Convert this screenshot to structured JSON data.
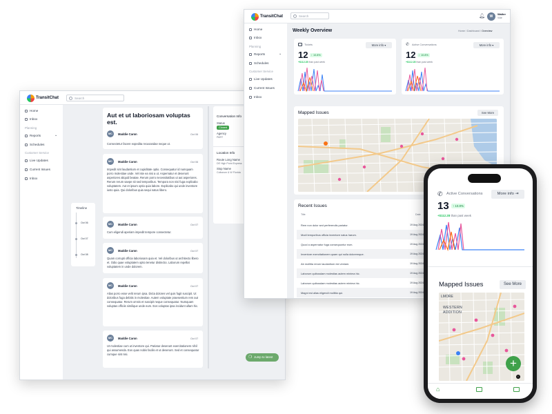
{
  "brand": {
    "name": "TransitChat"
  },
  "search": {
    "placeholder": "Search"
  },
  "nav": {
    "home": "Home",
    "inbox": "Inbox",
    "planning": "Planning",
    "reports": "Reports",
    "schedules": "Schedules",
    "customer_service": "Customer Service",
    "live_updates": "Live Updates",
    "current_issues": "Current Issues",
    "inbox2": "Inbox"
  },
  "conversation": {
    "title": "Aut et ut laboriosam voluptas est.",
    "messages": [
      {
        "initials": "MC",
        "author": "Maddie Caron",
        "date": "Oct 06",
        "text": "Consectetur facere expedita recusandae neque ut."
      },
      {
        "initials": "MC",
        "author": "Maddie Caron",
        "date": "Oct 06",
        "text": "Impedit sint laudantium et cupiditate optio. Consequatur id numquam porro molestiae unde. Vel iste ea nisi a ut. Aspernatur et deserunt asperiores aliquid beatae. Rerum porro necessitatibus ut aut asperiores. Rerum rerum saepe sit sed temporibus. Tempora non nisi fuga explicabo voluptatem. Aut et ipsum optio quia labore. Explicabo qui unde inventore iusto quia. Qui doloribus quia sequi natus libero."
      },
      {
        "initials": "MC",
        "author": "Maddie Caron",
        "date": "Oct 07",
        "text": "Cum eligendi aperiam impedit tempore consectetur."
      },
      {
        "initials": "MC",
        "author": "Maddie Caron",
        "date": "Oct 07",
        "text": "Quam corrupti officia laboriosam quia et. Vel doloribus ut architecto libero et. Odio quae voluptatem optio tenetur distinctio. Laborum repellat voluptatem in unde dolorem."
      },
      {
        "initials": "MC",
        "author": "Maddie Caron",
        "date": "Oct 07",
        "text": "Alias porro esse velit rerum ipsa. Dicta dolores vel quis fugit suscipit. Ut doloribus fuga debitis in molestiae. Autem voluptate praesentium rem aut consequatur. Rerum omnis et suscipit neque consequatur. Numquam voluptas officiis similique unde eum. Eos voluptas ipsa incidunt ullam hic."
      },
      {
        "initials": "MC",
        "author": "Maddie Caron",
        "date": "Oct 07",
        "text": "Ut molestiae cum ut inventore qui. Pariatur deserunt exercitationem nihil qui assumenda. Eos quas nobis facilis et ut deserunt. Sed et consequatur cumque sint nisi."
      }
    ]
  },
  "timeline": {
    "title": "Timeline",
    "dates": [
      "Oct 06",
      "Oct 07",
      "Oct 08"
    ]
  },
  "info_panel": {
    "conversation_info": "Conversation Info",
    "status_label": "Status",
    "status_value": "Closed",
    "agency_label": "Agency",
    "agency_value": "PART",
    "location_info": "Location Info",
    "route_label": "Route Long Name",
    "route_value": "DE High Point Express",
    "stop_label": "Stop Name",
    "stop_value": "Coliseum & W Florida"
  },
  "jump_button": {
    "label": "Jump to latest"
  },
  "dashboard": {
    "title": "Weekly Overview",
    "breadcrumb": [
      "Home",
      "Dashboard",
      "Overview"
    ],
    "user": {
      "name": "Walter",
      "role": "Vide",
      "initial": "W"
    },
    "tickets": {
      "label": "Tickets",
      "value": "12",
      "change": "10.8%",
      "delta": "+$112.28",
      "period": "than past week"
    },
    "conversations": {
      "label": "Active Conversations",
      "value": "12",
      "change": "10.8%",
      "delta": "+$112.28",
      "period": "than past week"
    },
    "more_info": "More info",
    "mapped_issues": "Mapped Issues",
    "see_more": "See More",
    "recent_issues": "Recent Issues",
    "table_headers": {
      "title": "Title",
      "date": "Date"
    },
    "issues": [
      {
        "title": "Rem non dolor sed perferendis pariatur.",
        "date": "19 Aug 2024"
      },
      {
        "title": "Modi temporibus officia inventore natus harum.",
        "date": "19 Aug 2024"
      },
      {
        "title": "Quod a aspernatur fuga consequuntur eum.",
        "date": "19 Aug 2024"
      },
      {
        "title": "Inventore exercitationem quam qui nulla doloremque.",
        "date": "19 Aug 2024"
      },
      {
        "title": "Ab mollitia rerum laudantium est veniam.",
        "date": "19 Aug 2024"
      },
      {
        "title": "Laborum quibusdam molestias autem minima hic.",
        "date": "19 Aug 2024"
      },
      {
        "title": "Laborum quibusdam molestias autem minima hic.",
        "date": "19 Aug 2024"
      },
      {
        "title": "Magni est alias eligendi mollitia qui.",
        "date": "19 Aug 2024"
      }
    ]
  },
  "mobile": {
    "label": "Active Conversations",
    "more_info": "More info",
    "value": "13",
    "change": "10.8%",
    "delta": "+$112.28",
    "period": "than past week",
    "mapped_issues": "Mapped Issues",
    "see_more": "See More",
    "map_labels": [
      "LMORE",
      "WESTERN",
      "ADDITION"
    ]
  },
  "colors": {
    "accent": "#3fa14a",
    "pink": "#e8579b",
    "blue": "#3b82f6",
    "orange": "#f97316"
  }
}
